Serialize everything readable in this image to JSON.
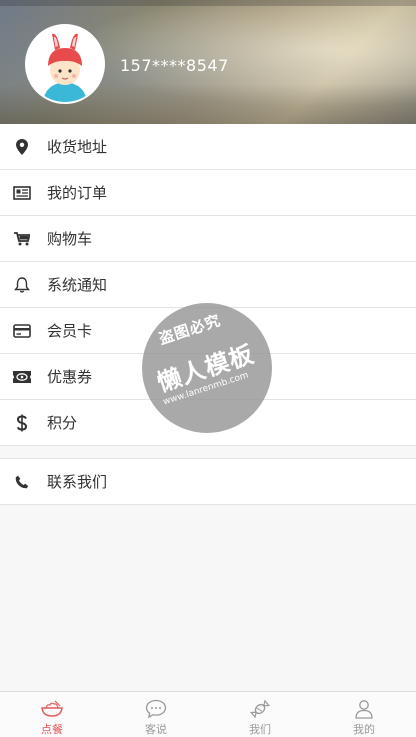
{
  "profile": {
    "phone": "157****8547"
  },
  "menu": {
    "items": [
      {
        "label": "收货地址",
        "icon": "location-pin-icon"
      },
      {
        "label": "我的订单",
        "icon": "order-list-icon"
      },
      {
        "label": "购物车",
        "icon": "shopping-cart-icon"
      },
      {
        "label": "系统通知",
        "icon": "bell-icon"
      },
      {
        "label": "会员卡",
        "icon": "credit-card-icon"
      },
      {
        "label": "优惠券",
        "icon": "coupon-icon"
      },
      {
        "label": "积分",
        "icon": "dollar-icon"
      }
    ],
    "contact": {
      "label": "联系我们",
      "icon": "phone-icon"
    }
  },
  "watermark": {
    "line1": "盗图必究",
    "line2": "懒人模板",
    "line3": "www.lanrenmb.com"
  },
  "tabbar": {
    "tabs": [
      {
        "label": "点餐",
        "icon": "bowl-icon",
        "active": true
      },
      {
        "label": "客说",
        "icon": "chat-bubble-icon",
        "active": false
      },
      {
        "label": "我们",
        "icon": "candy-icon",
        "active": false
      },
      {
        "label": "我的",
        "icon": "user-icon",
        "active": false
      }
    ]
  },
  "colors": {
    "accent": "#e35a5a",
    "divider": "#e3e3e3",
    "background": "#f7f7f7"
  }
}
